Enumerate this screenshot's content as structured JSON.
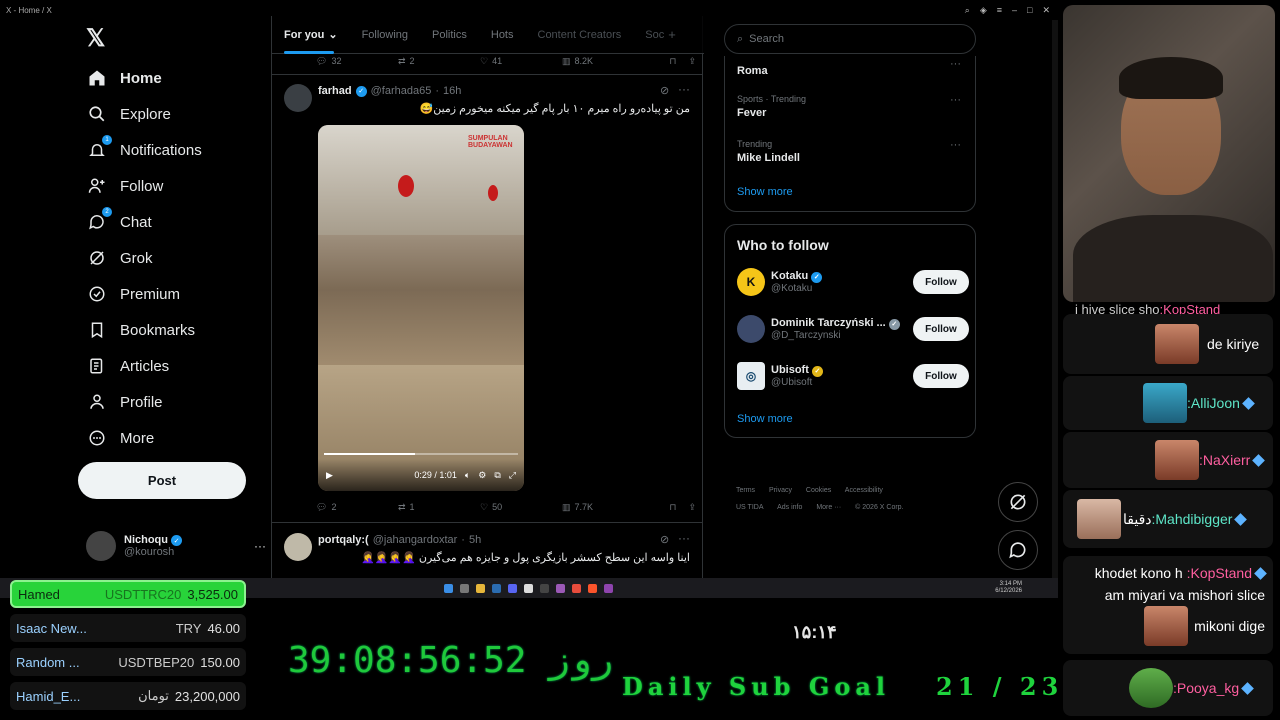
{
  "window": {
    "title": "X - Home / X"
  },
  "nav": {
    "items": [
      {
        "label": "Home",
        "icon": "home-icon"
      },
      {
        "label": "Explore",
        "icon": "search-icon"
      },
      {
        "label": "Notifications",
        "icon": "bell-icon",
        "badge": "1"
      },
      {
        "label": "Follow",
        "icon": "person-add-icon"
      },
      {
        "label": "Chat",
        "icon": "chat-icon",
        "badge": "2"
      },
      {
        "label": "Grok",
        "icon": "grok-icon"
      },
      {
        "label": "Premium",
        "icon": "premium-icon"
      },
      {
        "label": "Bookmarks",
        "icon": "bookmark-icon"
      },
      {
        "label": "Articles",
        "icon": "articles-icon"
      },
      {
        "label": "Profile",
        "icon": "person-icon"
      },
      {
        "label": "More",
        "icon": "more-icon"
      }
    ],
    "post_label": "Post",
    "account": {
      "name": "Nichoqu",
      "handle": "@kourosh"
    }
  },
  "tabs": [
    "For you",
    "Following",
    "Politics",
    "Hots",
    "Content Creators",
    "Soc"
  ],
  "top_actions": {
    "replies": "32",
    "reposts": "2",
    "likes": "41",
    "views": "8.2K"
  },
  "tweets": [
    {
      "name": "farhad",
      "handle": "@farhada65",
      "time": "16h",
      "text": "من تو پیاده‌رو راه میرم ۱۰ بار پام گیر میکنه میخورم زمین😅",
      "video_time": "0:29 / 1:01",
      "video_progress": 0.47,
      "replies": "2",
      "reposts": "1",
      "likes": "50",
      "views": "7.7K"
    },
    {
      "name": "portqaly:(",
      "handle": "@jahangardoxtar",
      "time": "5h",
      "text": "اینا واسه این سطح کسشر بازیگری پول و جایزه هم می‌گیرن 🤦‍♀️🤦‍♀️🤦‍♀️🤦‍♀️"
    }
  ],
  "search": {
    "placeholder": "Search"
  },
  "trends": [
    {
      "meta": "",
      "name": "Roma"
    },
    {
      "meta": "Sports · Trending",
      "name": "Fever"
    },
    {
      "meta": "Trending",
      "name": "Mike Lindell"
    }
  ],
  "trends_show_more": "Show more",
  "who_to_follow": {
    "title": "Who to follow",
    "accounts": [
      {
        "name": "Kotaku",
        "handle": "@Kotaku",
        "badge": "blue",
        "follow": "Follow"
      },
      {
        "name": "Dominik Tarczyński ...",
        "handle": "@D_Tarczynski",
        "badge": "grey",
        "follow": "Follow"
      },
      {
        "name": "Ubisoft",
        "handle": "@Ubisoft",
        "badge": "gold",
        "follow": "Follow"
      }
    ],
    "show_more": "Show more"
  },
  "footer": [
    "Terms",
    "Privacy",
    "Cookies",
    "Accessibility",
    "US TIDA",
    "Ads info",
    "More ···",
    "© 2026 X Corp."
  ],
  "taskbar": {
    "time": "3:14 PM",
    "date": "6/12/2026"
  },
  "chat": [
    {
      "text": "i hive slice sho",
      "user": ":KopStand",
      "user_color": "pink"
    },
    {
      "text": "de kiriye",
      "user": "",
      "emote": true
    },
    {
      "text": "",
      "user": ":AlliJoon",
      "user_color": "teal"
    },
    {
      "text": "",
      "user": ":NaXierr",
      "user_color": "pink"
    },
    {
      "text": "دقیقا",
      "user": ":Mahdibigger",
      "user_color": "teal"
    },
    {
      "text": "khodet kono h",
      "text2": "am miyari va mishori slice",
      "text3": "mikoni dige",
      "user": ":KopStand",
      "user_color": "pink"
    },
    {
      "text": "",
      "user": ":Pooya_kg",
      "user_color": "pink"
    }
  ],
  "donors": [
    {
      "name": "Hamed",
      "currency": "USDTTRC20",
      "amount": "3,525.00"
    },
    {
      "name": "Isaac New...",
      "currency": "TRY",
      "amount": "46.00"
    },
    {
      "name": "Random ...",
      "currency": "USDTBEP20",
      "amount": "150.00"
    },
    {
      "name": "Hamid_E...",
      "currency": "تومان",
      "amount": "23,200,000"
    }
  ],
  "overlay": {
    "countdown": "روز 39:08:56:52",
    "clock": "۱۵:۱۴",
    "sub_goal_label": "Daily Sub Goal",
    "sub_goal_count": "21 / 23"
  },
  "colors": {
    "accent": "#1d9bf0",
    "overlay_green": "#1fd33d",
    "chat_teal": "#5ee6c8",
    "chat_pink": "#ff5fa0"
  }
}
